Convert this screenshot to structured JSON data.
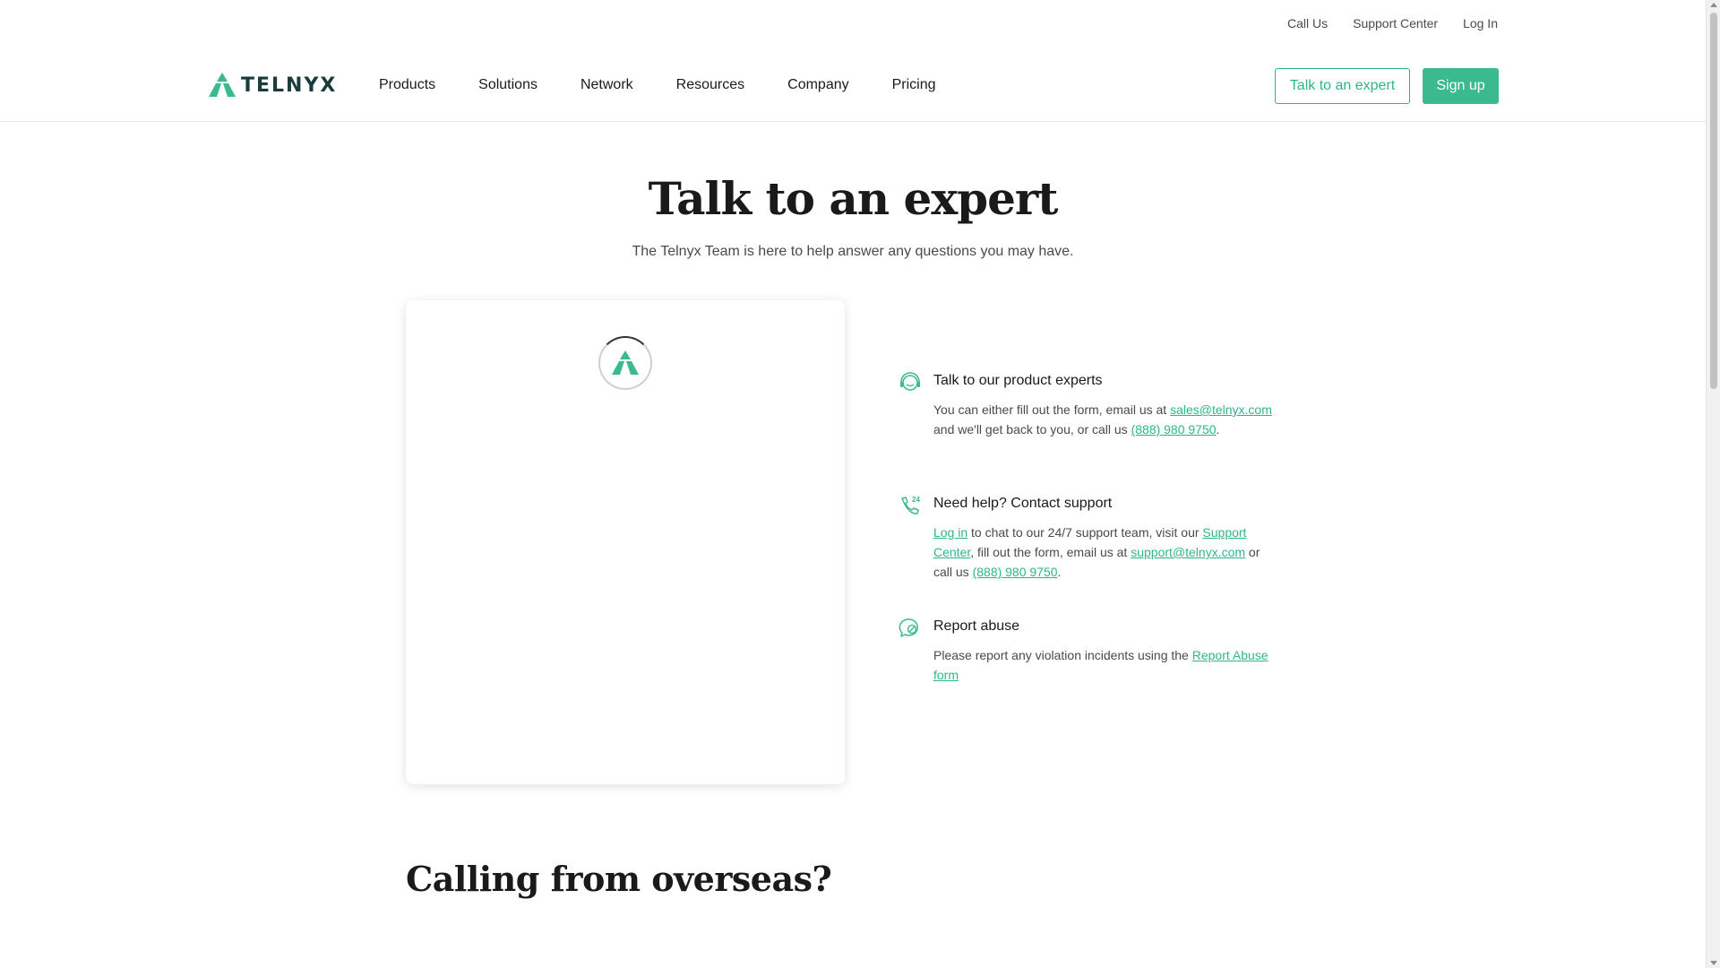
{
  "utility": {
    "call_us": "Call Us",
    "support_center": "Support Center",
    "log_in": "Log In"
  },
  "header": {
    "logo_text": "TELNYX",
    "nav": [
      "Products",
      "Solutions",
      "Network",
      "Resources",
      "Company",
      "Pricing"
    ],
    "talk_button": "Talk to an expert",
    "signup_button": "Sign up"
  },
  "hero": {
    "title": "Talk to an expert",
    "subtitle": "The Telnyx Team is here to help answer any questions you may have."
  },
  "contact": {
    "experts": {
      "title": "Talk to our product experts",
      "text_1": "You can either fill out the form, email us at ",
      "email": "sales@telnyx.com",
      "text_2": " and we'll get back to you, or call us ",
      "phone": "(888) 980 9750",
      "text_3": "."
    },
    "support": {
      "title": "Need help? Contact support",
      "login_link": "Log in",
      "text_1": " to chat to our 24/7 support team, visit our ",
      "support_center_link": "Support Center",
      "text_2": ", fill out the form, email us at ",
      "email": "support@telnyx.com",
      "text_3": " or call us ",
      "phone": "(888) 980 9750",
      "text_4": "."
    },
    "abuse": {
      "title": "Report abuse",
      "text_1": "Please report any violation incidents using the ",
      "link": "Report Abuse form"
    }
  },
  "overseas": {
    "title": "Calling from overseas?"
  },
  "colors": {
    "accent": "#3cba8f",
    "link": "#2fb58a",
    "logo_dark": "#1b3a3a"
  },
  "icons": {
    "logo": "telnyx-triangle-logo",
    "experts": "headset-icon",
    "support": "phone-24-icon",
    "abuse": "chat-report-icon",
    "loading": "loading-spinner-icon"
  }
}
